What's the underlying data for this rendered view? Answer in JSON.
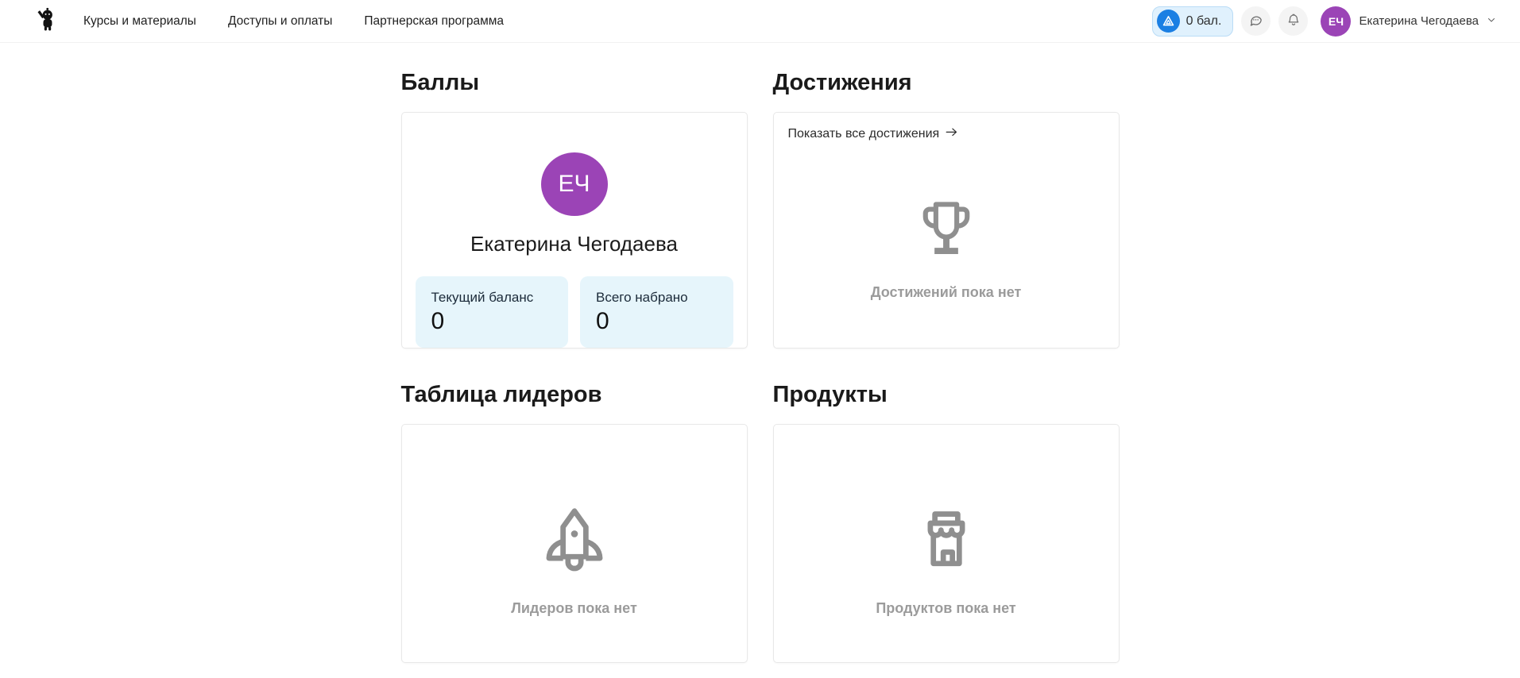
{
  "header": {
    "nav": [
      {
        "label": "Курсы и материалы"
      },
      {
        "label": "Доступы и оплаты"
      },
      {
        "label": "Партнерская программа"
      }
    ],
    "points_badge": "0 бал.",
    "user": {
      "initials": "ЕЧ",
      "name": "Екатерина Чегодаева"
    }
  },
  "sections": {
    "points": {
      "title": "Баллы",
      "user_initials": "ЕЧ",
      "user_name": "Екатерина Чегодаева",
      "stats": [
        {
          "label": "Текущий баланс",
          "value": "0"
        },
        {
          "label": "Всего набрано",
          "value": "0"
        }
      ]
    },
    "achievements": {
      "title": "Достижения",
      "show_all_label": "Показать все достижения",
      "empty_text": "Достижений пока нет"
    },
    "leaderboard": {
      "title": "Таблица лидеров",
      "empty_text": "Лидеров пока нет"
    },
    "products": {
      "title": "Продукты",
      "empty_text": "Продуктов пока нет"
    }
  },
  "colors": {
    "accent_blue": "#1b7fe3",
    "badge_bg": "#e0f1fd",
    "badge_border": "#b9dcf6",
    "avatar_purple": "#9b44b6",
    "stat_box_bg": "#e6f5fb",
    "icon_gray": "#8f8f8f",
    "empty_text_gray": "#9b9b9b"
  }
}
